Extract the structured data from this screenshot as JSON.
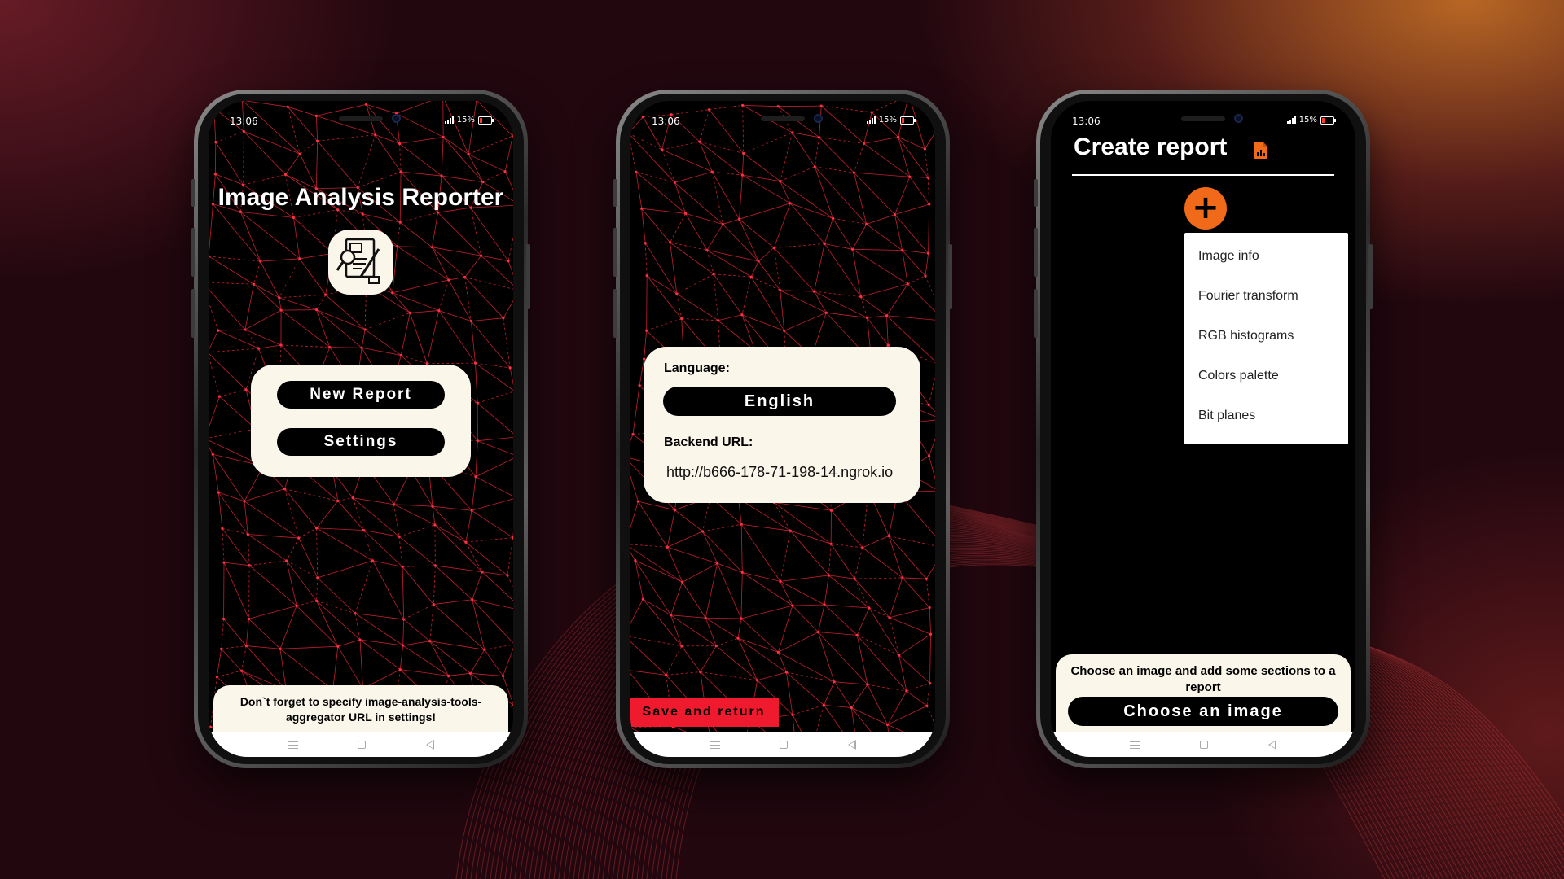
{
  "colors": {
    "cream": "#fbf6ea",
    "pattern_line": "#c21f2f",
    "save_red": "#ef1a2d",
    "add_orange": "#f06a1a"
  },
  "status_bar": {
    "time": "13:06",
    "battery": "15%"
  },
  "home_screen": {
    "title": "Image Analysis Reporter",
    "logo_icon": "report-analysis-icon",
    "new_report_label": "New Report",
    "settings_label": "Settings",
    "hint": "Don`t forget to specify image-analysis-tools-aggregator URL in settings!"
  },
  "settings_screen": {
    "language_label": "Language:",
    "language_value": "English",
    "backend_label": "Backend URL:",
    "backend_url": "http://b666-178-71-198-14.ngrok.io",
    "save_label": "Save and return"
  },
  "report_screen": {
    "title": "Create report",
    "title_icon": "report-file-icon",
    "add_icon": "+",
    "menu_items": [
      "Image info",
      "Fourier transform",
      "RGB histograms",
      "Colors palette",
      "Bit planes"
    ],
    "hint": "Choose an image and add some sections to a report",
    "choose_label": "Choose an image"
  }
}
